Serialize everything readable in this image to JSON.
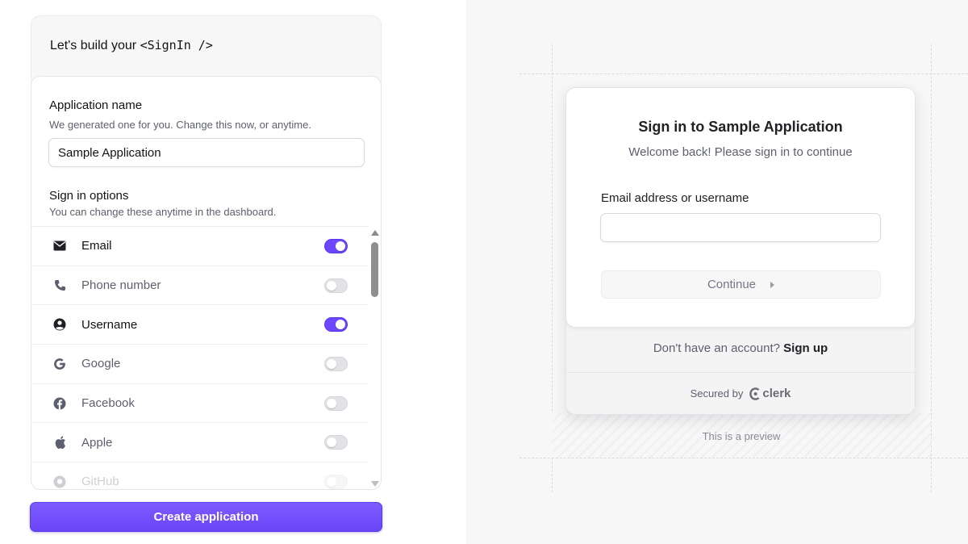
{
  "config": {
    "title_prefix": "Let's build your ",
    "title_code": "<SignIn />",
    "app_name": {
      "label": "Application name",
      "help": "We generated one for you. Change this now, or anytime.",
      "value": "Sample Application"
    },
    "sign_in_options": {
      "label": "Sign in options",
      "help": "You can change these anytime in the dashboard."
    },
    "options": [
      {
        "label": "Email",
        "enabled": true,
        "icon": "envelope-icon"
      },
      {
        "label": "Phone number",
        "enabled": false,
        "icon": "phone-icon"
      },
      {
        "label": "Username",
        "enabled": true,
        "icon": "user-circle-icon"
      },
      {
        "label": "Google",
        "enabled": false,
        "icon": "google-icon"
      },
      {
        "label": "Facebook",
        "enabled": false,
        "icon": "facebook-icon"
      },
      {
        "label": "Apple",
        "enabled": false,
        "icon": "apple-icon"
      },
      {
        "label": "GitHub",
        "enabled": false,
        "icon": "github-icon"
      }
    ],
    "create_button": "Create application"
  },
  "preview": {
    "title": "Sign in to Sample Application",
    "subtitle": "Welcome back! Please sign in to continue",
    "email_label": "Email address or username",
    "email_value": "",
    "continue_label": "Continue",
    "signup_prompt": "Don't have an account?",
    "signup_link": "Sign up",
    "secured_by": "Secured by",
    "brand": "clerk",
    "note": "This is a preview"
  },
  "colors": {
    "accent": "#6c47ff",
    "panel_bg": "#f7f7f8"
  }
}
